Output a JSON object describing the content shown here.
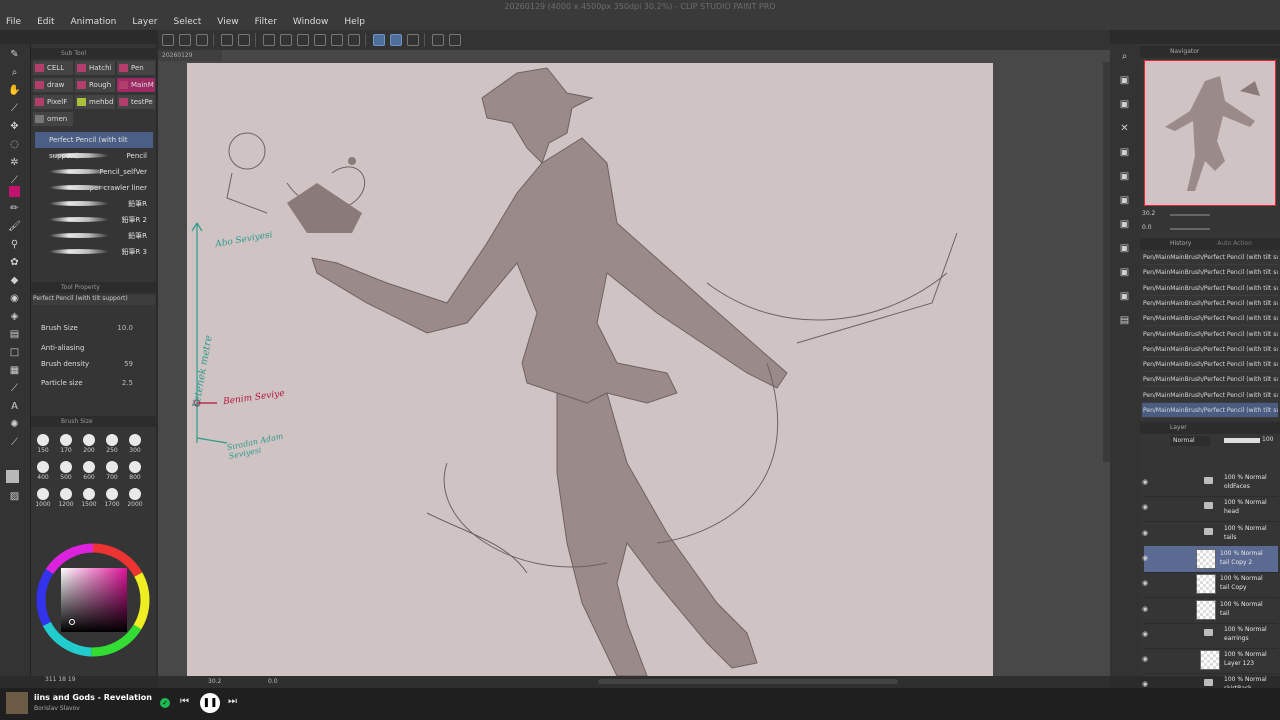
{
  "window": {
    "title": "20260129 (4000 x 4500px 350dpi 30.2%) - CLIP STUDIO PAINT PRO"
  },
  "menu": [
    "File",
    "Edit",
    "Animation",
    "Layer",
    "Select",
    "View",
    "Filter",
    "Window",
    "Help"
  ],
  "document_tab": "20260129",
  "subtool": {
    "panel_title": "Sub Tool",
    "tabs": [
      "CELL",
      "Hatchi",
      "Pen",
      "draw",
      "Rough",
      "MainM",
      "PixelF",
      "mehbd",
      "testPe",
      "ornen"
    ],
    "brushes": [
      "Perfect Pencil (with tilt support)",
      "Pencil",
      "Pencil_selfVer",
      "creeper crawler liner",
      "鉛筆R",
      "鉛筆R 2",
      "鉛筆R",
      "鉛筆R 3"
    ]
  },
  "tool_property": {
    "panel_title": "Tool Property",
    "brush_name": "Perfect Pencil (with tilt support)",
    "brush_size_label": "Brush Size",
    "brush_size_value": "10.0",
    "anti_aliasing_label": "Anti-aliasing",
    "brush_density_label": "Brush density",
    "brush_density_value": "59",
    "particle_size_label": "Particle size",
    "particle_size_value": "2.5"
  },
  "brush_size_palette": {
    "panel_title": "Brush Size",
    "sizes": [
      "150",
      "170",
      "200",
      "250",
      "300",
      "400",
      "500",
      "600",
      "700",
      "800",
      "1000",
      "1200",
      "1500",
      "1700",
      "2000"
    ]
  },
  "color": {
    "current_main": "#c1126d",
    "readout": "311 18 19"
  },
  "canvas": {
    "annotations": [
      {
        "text": "Abo Seviyesi",
        "color": "#2f9b8c"
      },
      {
        "text": "Yetenek metre",
        "color": "#2f9b8c"
      },
      {
        "text": "Benim Seviye",
        "color": "#b1163c"
      },
      {
        "text": "Sıradan Adam Seviyesi",
        "color": "#2f9b8c"
      }
    ]
  },
  "status": {
    "zoom": "30.2",
    "angle": "0.0"
  },
  "navigator": {
    "panel_title": "Navigator",
    "zoom": "30.2",
    "rotation": "0.0"
  },
  "history": {
    "tabs": [
      "History",
      "Auto Action"
    ],
    "items": [
      "Pen/MainMainBrush/Perfect Pencil (with tilt support)",
      "Pen/MainMainBrush/Perfect Pencil (with tilt support)",
      "Pen/MainMainBrush/Perfect Pencil (with tilt support)",
      "Pen/MainMainBrush/Perfect Pencil (with tilt support)",
      "Pen/MainMainBrush/Perfect Pencil (with tilt support)",
      "Pen/MainMainBrush/Perfect Pencil (with tilt support)",
      "Pen/MainMainBrush/Perfect Pencil (with tilt support)",
      "Pen/MainMainBrush/Perfect Pencil (with tilt support)",
      "Pen/MainMainBrush/Perfect Pencil (with tilt support)",
      "Pen/MainMainBrush/Perfect Pencil (with tilt support)",
      "Pen/MainMainBrush/Perfect Pencil (with tilt support)"
    ]
  },
  "layers": {
    "panel_title": "Layer",
    "blend_mode": "Normal",
    "opacity": "100",
    "items": [
      {
        "mode": "100 % Normal",
        "name": "oldFaces",
        "type": "folder"
      },
      {
        "mode": "100 % Normal",
        "name": "head",
        "type": "folder"
      },
      {
        "mode": "100 % Normal",
        "name": "tails",
        "type": "folder"
      },
      {
        "mode": "100 % Normal",
        "name": "tail Copy 2",
        "type": "raster",
        "selected": true
      },
      {
        "mode": "100 % Normal",
        "name": "tail Copy",
        "type": "raster"
      },
      {
        "mode": "100 % Normal",
        "name": "tail",
        "type": "raster"
      },
      {
        "mode": "100 % Normal",
        "name": "earrings",
        "type": "folder"
      },
      {
        "mode": "100 % Normal",
        "name": "Layer 123",
        "type": "raster"
      },
      {
        "mode": "100 % Normal",
        "name": "skirtBack",
        "type": "folder"
      }
    ]
  },
  "media": {
    "track": "iins and Gods - Revelation",
    "artist": "Borislav Slavov",
    "accent": "#1db954"
  }
}
